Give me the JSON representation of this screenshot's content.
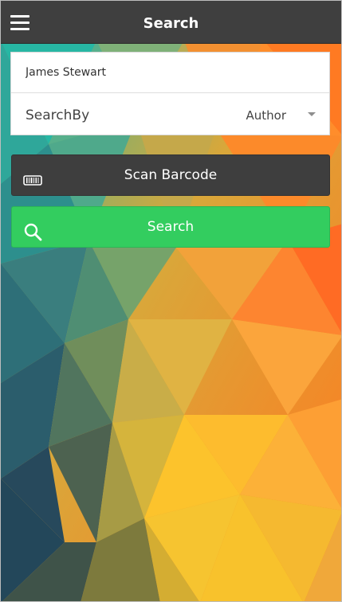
{
  "header": {
    "title": "Search",
    "menu_icon": "hamburger-menu-icon"
  },
  "form": {
    "name_value": "James Stewart",
    "searchby_label": "SearchBy",
    "searchby_selected": "Author"
  },
  "buttons": {
    "scan_label": "Scan Barcode",
    "scan_icon": "barcode-icon",
    "search_label": "Search",
    "search_icon": "search-icon"
  },
  "colors": {
    "header_bg": "#3f3f3f",
    "scan_button_bg": "#3e3e3e",
    "search_button_bg": "#33cd5f"
  }
}
